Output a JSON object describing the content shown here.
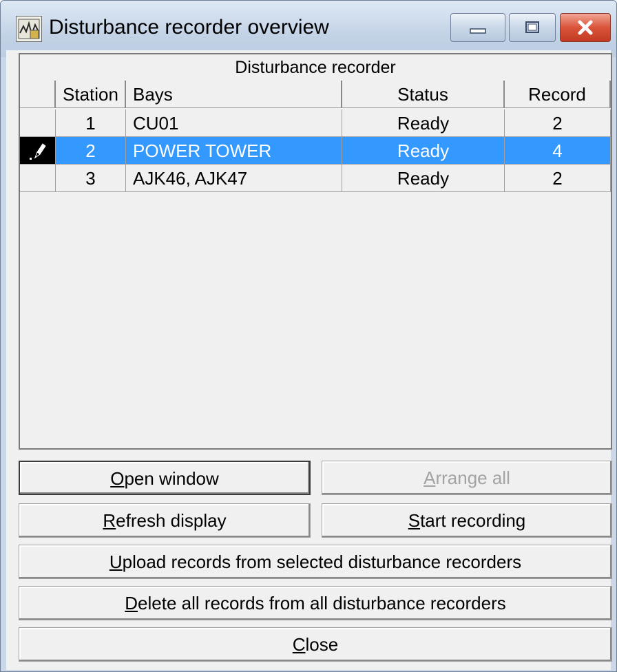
{
  "window": {
    "title": "Disturbance recorder overview"
  },
  "grid": {
    "caption": "Disturbance recorder",
    "columns": {
      "station": "Station",
      "bays": "Bays",
      "status": "Status",
      "record": "Record"
    },
    "rows": [
      {
        "station": "1",
        "bays": "CU01",
        "status": "Ready",
        "record": "2",
        "selected": false
      },
      {
        "station": "2",
        "bays": "POWER TOWER",
        "status": "Ready",
        "record": "4",
        "selected": true
      },
      {
        "station": "3",
        "bays": "AJK46, AJK47",
        "status": "Ready",
        "record": "2",
        "selected": false
      }
    ]
  },
  "buttons": {
    "open_window": {
      "mnemonic": "O",
      "rest": "pen window"
    },
    "arrange_all": {
      "mnemonic": "A",
      "rest": "rrange all",
      "enabled": false
    },
    "refresh_display": {
      "mnemonic": "R",
      "rest": "efresh display"
    },
    "start_recording": {
      "mnemonic": "S",
      "rest": "tart recording"
    },
    "upload_records": {
      "mnemonic": "U",
      "rest": "pload records from selected disturbance recorders"
    },
    "delete_all": {
      "mnemonic": "D",
      "rest": "elete all records from all disturbance recorders"
    },
    "close": {
      "mnemonic": "C",
      "rest": "lose"
    }
  },
  "icons": {
    "app": "disturbance-recorder-app-icon",
    "row_edit": "pencil-icon",
    "minimize": "minimize-icon",
    "maximize": "maximize-icon",
    "close": "close-icon"
  },
  "colors": {
    "selection": "#3399ff",
    "close_button": "#d9543b"
  }
}
